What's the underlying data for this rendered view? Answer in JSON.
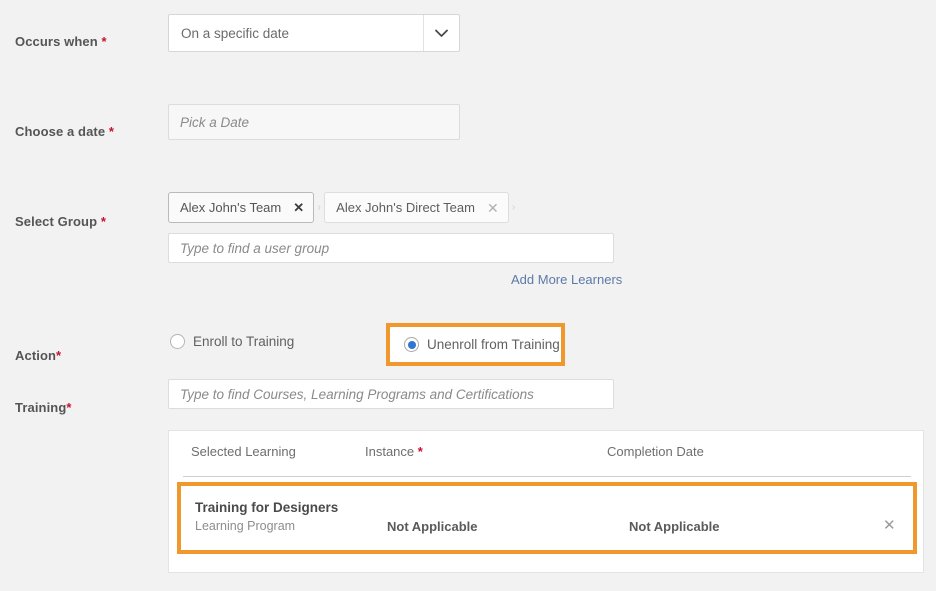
{
  "fields": {
    "occurs_when": {
      "label": "Occurs when ",
      "required_mark": "*",
      "selected_option": "On a specific date"
    },
    "choose_date": {
      "label": "Choose a date ",
      "required_mark": "*",
      "placeholder": "Pick a Date"
    },
    "select_group": {
      "label": "Select Group ",
      "required_mark": "*",
      "placeholder": "Type to find a user group",
      "chips": [
        {
          "label": "Alex John's Team",
          "remove_icon": "✕"
        },
        {
          "label": "Alex John's Direct Team",
          "remove_icon": "✕"
        }
      ],
      "separator": "›",
      "add_more_link": "Add More Learners"
    },
    "action": {
      "label": "Action",
      "required_mark": "*",
      "options": [
        {
          "label": "Enroll to Training",
          "selected": false
        },
        {
          "label": "Unenroll from Training",
          "selected": true
        }
      ]
    },
    "training": {
      "label": "Training",
      "required_mark": "*",
      "placeholder": "Type to find Courses, Learning Programs and Certifications"
    }
  },
  "table": {
    "headers": [
      {
        "text": "Selected Learning",
        "required_mark": ""
      },
      {
        "text": "Instance ",
        "required_mark": "*"
      },
      {
        "text": "Completion Date",
        "required_mark": ""
      }
    ],
    "rows": [
      {
        "title": "Training for Designers",
        "subtitle": "Learning Program",
        "instance": "Not Applicable",
        "completion_date": "Not Applicable",
        "remove_icon": "✕"
      }
    ]
  },
  "colors": {
    "highlight_orange": "#F0982E",
    "radio_selected_blue": "#2F76D4",
    "required_red": "#C8102E",
    "link_blue": "#5C7AA8",
    "page_background": "#F2F2F2"
  }
}
